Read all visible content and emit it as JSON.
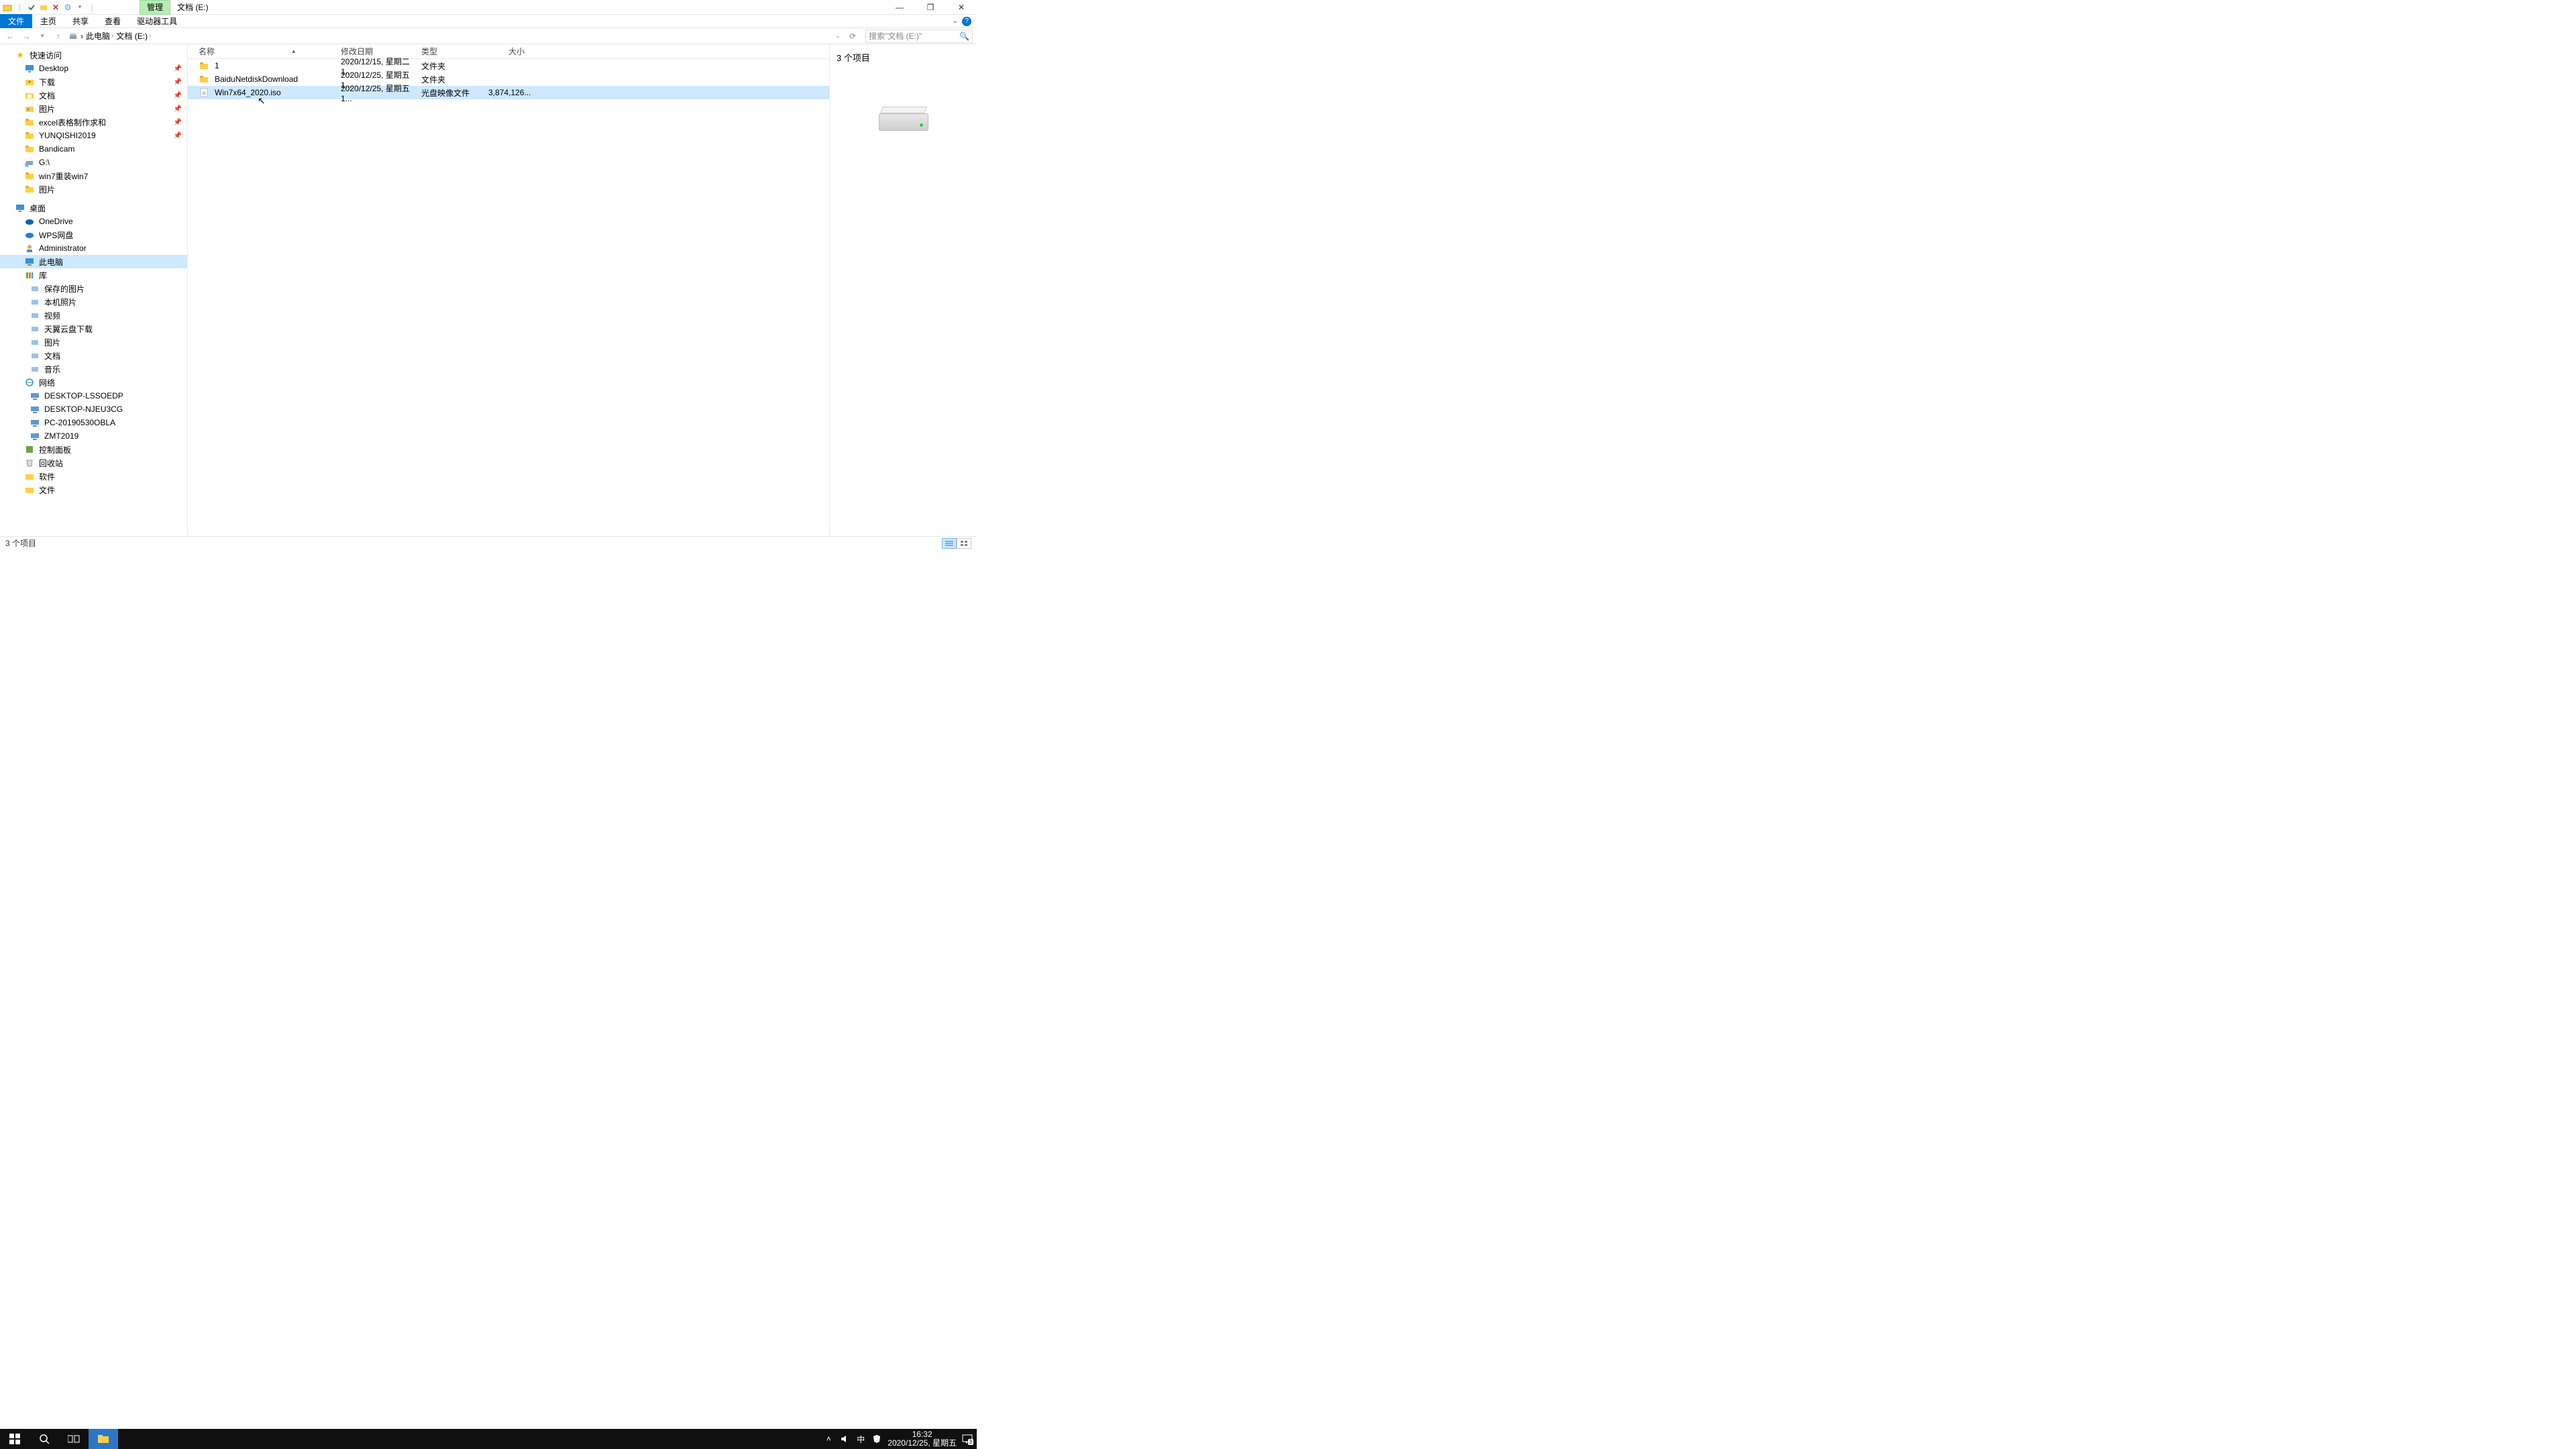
{
  "colors": {
    "accent": "#0078d7",
    "selection": "#cde8ff",
    "manage_tab": "#b6ecb6"
  },
  "titlebar": {
    "manage_tab": "管理",
    "title": "文档 (E:)",
    "window_controls": {
      "min": "—",
      "max": "❐",
      "close": "✕"
    }
  },
  "ribbon": {
    "file": "文件",
    "tabs": [
      "主页",
      "共享",
      "查看",
      "驱动器工具"
    ],
    "help": "?"
  },
  "address": {
    "crumbs": [
      "此电脑",
      "文档 (E:)"
    ],
    "refresh_title": "刷新",
    "search_placeholder": "搜索\"文档 (E:)\""
  },
  "nav": {
    "quick_access": "快速访问",
    "pinned": [
      {
        "name": "Desktop",
        "icon": "desktop"
      },
      {
        "name": "下载",
        "icon": "downloads"
      },
      {
        "name": "文档",
        "icon": "documents"
      },
      {
        "name": "图片",
        "icon": "pictures"
      },
      {
        "name": "excel表格制作求和",
        "icon": "folder"
      },
      {
        "name": "YUNQISHI2019",
        "icon": "folder"
      }
    ],
    "recent": [
      {
        "name": "Bandicam",
        "icon": "folder"
      },
      {
        "name": "G:\\",
        "icon": "shortcut"
      },
      {
        "name": "win7重装win7",
        "icon": "folder"
      },
      {
        "name": "图片",
        "icon": "folder"
      }
    ],
    "desktop": "桌面",
    "desktop_children": [
      {
        "name": "OneDrive",
        "icon": "onedrive"
      },
      {
        "name": "WPS网盘",
        "icon": "wps"
      },
      {
        "name": "Administrator",
        "icon": "user"
      },
      {
        "name": "此电脑",
        "icon": "thispc",
        "selected": true
      },
      {
        "name": "库",
        "icon": "library"
      }
    ],
    "library_children": [
      "保存的图片",
      "本机照片",
      "视频",
      "天翼云盘下载",
      "图片",
      "文档",
      "音乐"
    ],
    "network": "网络",
    "network_children": [
      "DESKTOP-LSSOEDP",
      "DESKTOP-NJEU3CG",
      "PC-20190530OBLA",
      "ZMT2019"
    ],
    "control_panel": "控制面板",
    "recycle_bin": "回收站",
    "software": "软件",
    "files_folder": "文件"
  },
  "columns": {
    "name": "名称",
    "date": "修改日期",
    "type": "类型",
    "size": "大小"
  },
  "files": [
    {
      "name": "1",
      "date": "2020/12/15, 星期二 1...",
      "type": "文件夹",
      "size": "",
      "icon": "folder"
    },
    {
      "name": "BaiduNetdiskDownload",
      "date": "2020/12/25, 星期五 1...",
      "type": "文件夹",
      "size": "",
      "icon": "folder"
    },
    {
      "name": "Win7x64_2020.iso",
      "date": "2020/12/25, 星期五 1...",
      "type": "光盘映像文件",
      "size": "3,874,126...",
      "icon": "iso",
      "selected": true
    }
  ],
  "preview": {
    "title": "3 个项目"
  },
  "statusbar": {
    "text": "3 个项目"
  },
  "taskbar": {
    "ime": "中",
    "time": "16:32",
    "date": "2020/12/25, 星期五",
    "notif_count": "3"
  }
}
